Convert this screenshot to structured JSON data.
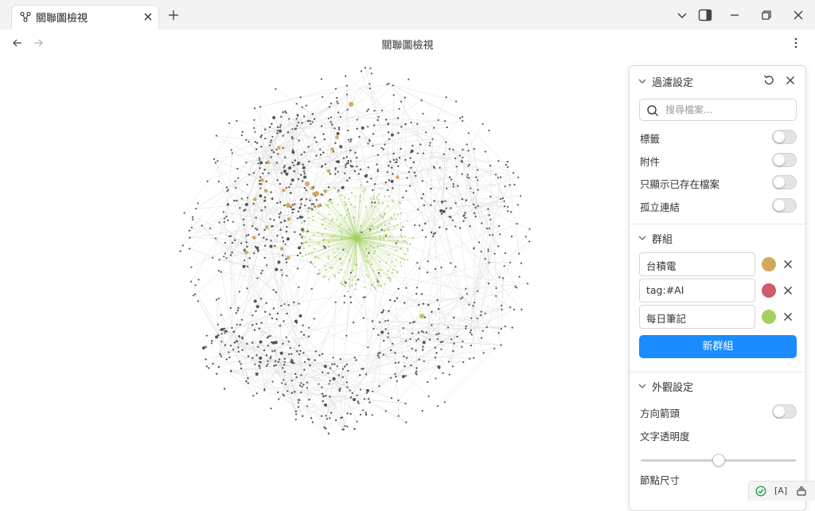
{
  "tab": {
    "title": "關聯圖檢視",
    "icon": "graph-icon"
  },
  "window": {
    "controls": [
      "chevron-down-icon",
      "sidebar-toggle-icon",
      "minimize-icon",
      "restore-icon",
      "close-icon"
    ]
  },
  "nav": {
    "title": "關聯圖檢視"
  },
  "filters": {
    "title": "過濾設定",
    "search_placeholder": "搜尋檔案...",
    "search_value": "",
    "options": [
      {
        "label": "標籤",
        "enabled": false
      },
      {
        "label": "附件",
        "enabled": false
      },
      {
        "label": "只顯示已存在檔案",
        "enabled": false
      },
      {
        "label": "孤立連結",
        "enabled": false
      }
    ]
  },
  "groups": {
    "title": "群組",
    "items": [
      {
        "query": "台積電",
        "color": "#d4a85c"
      },
      {
        "query": "tag:#AI",
        "color": "#d05a6a"
      },
      {
        "query": "每日筆記",
        "color": "#a3cf62"
      }
    ],
    "new_group_label": "新群組"
  },
  "appearance": {
    "title": "外觀設定",
    "arrows_label": "方向箭頭",
    "arrows_enabled": false,
    "text_opacity_label": "文字透明度",
    "text_opacity": 0.5,
    "node_size_label": "節點尺寸"
  },
  "statusbar": {
    "sync": "check-circle-icon",
    "label": "[A]"
  },
  "colors": {
    "accent": "#1a8cff",
    "node": "#555555",
    "edge": "#d8d8d8"
  }
}
